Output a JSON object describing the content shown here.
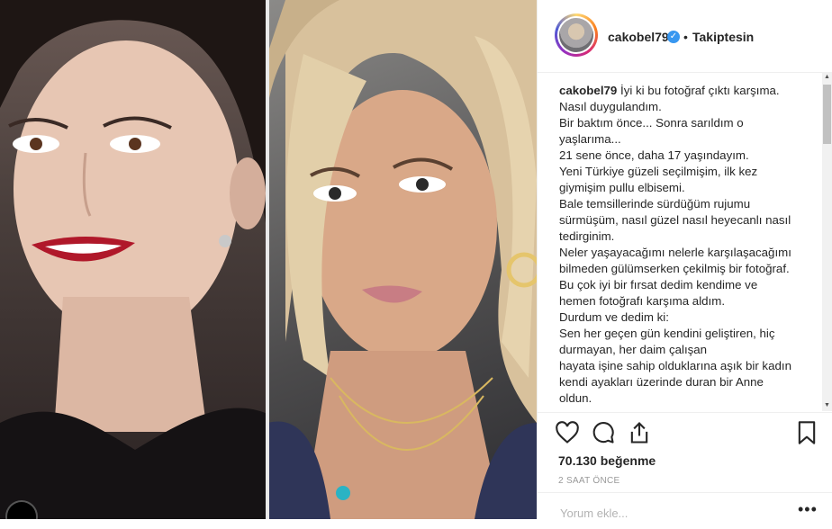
{
  "post": {
    "username": "cakobel79",
    "verified_mark": "✓",
    "separator": "•",
    "follow_label": "Takiptesin",
    "caption_user": "cakobel79",
    "caption_lines": [
      "İyi ki bu fotoğraf çıktı karşıma.",
      "Nasıl duygulandım.",
      "Bir baktım önce... Sonra sarıldım o",
      "yaşlarıma...",
      "21 sene önce, daha 17 yaşındayım.",
      "Yeni Türkiye güzeli seçilmişim, ilk kez",
      "giymişim pullu elbisemi.",
      "Bale temsillerinde sürdüğüm rujumu",
      "sürmüşüm, nasıl güzel nasıl heyecanlı nasıl",
      "tedirginim.",
      "Neler yaşayacağımı nelerle karşılaşacağımı",
      "bilmeden gülümserken çekilmiş bir fotoğraf.",
      "Bu çok iyi bir fırsat dedim kendime ve",
      "hemen fotoğrafı karşıma aldım.",
      "Durdum ve dedim ki:",
      "Sen her geçen gün kendini geliştiren, hiç",
      "durmayan, her daim çalışan",
      "hayata işine sahip olduklarına aşık bir kadın",
      "kendi ayakları üzerinde duran bir Anne",
      "oldun."
    ],
    "likes": "70.130 beğenme",
    "time": "2 SAAT ÖNCE",
    "comment_placeholder": "Yorum ekle...",
    "more": "•••"
  },
  "scrollbar": {
    "up": "▲",
    "down": "▼"
  },
  "icons": {
    "heart": "heart-icon",
    "comment": "comment-icon",
    "share": "share-icon",
    "save": "bookmark-icon"
  },
  "colors": {
    "verified": "#3897f0",
    "text": "#262626",
    "muted": "#999999"
  }
}
